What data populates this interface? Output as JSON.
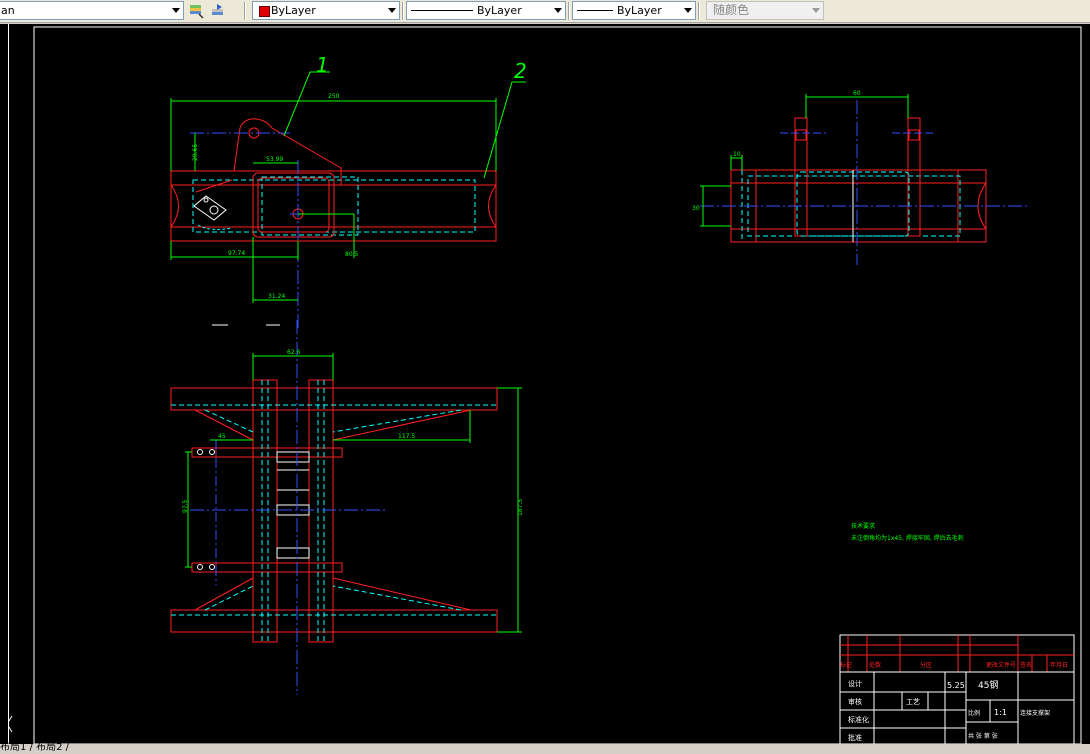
{
  "toolbar": {
    "layer_tail": "an",
    "color_label": "ByLayer",
    "linetype_label": "ByLayer",
    "lineweight_label": "ByLayer",
    "plotstyle_label": "随颜色",
    "color_swatch": "#e00000"
  },
  "drawing": {
    "callouts": [
      "1",
      "2"
    ],
    "top_view_dims": [
      "250",
      "29.65",
      "53.99",
      "97.74",
      "31.24",
      "80.5"
    ],
    "side_view_dims": [
      "60",
      "10",
      "30"
    ],
    "plan_view_dims": [
      "62.6",
      "45",
      "117.5",
      "97.5",
      "187.5"
    ],
    "notes": [
      "技术要求",
      "未注倒角均为1x45, 焊接牢固, 焊后去毛刺"
    ]
  },
  "title_block": {
    "rows_top": [
      "",
      ""
    ],
    "header": [
      "标记",
      "处数",
      "分区",
      "更改文件号",
      "签名",
      "年月日"
    ],
    "design": "设计",
    "review": "审核",
    "standard": "标准化",
    "process": "工艺",
    "approve": "批准",
    "weight": "5.25",
    "material": "45钢",
    "scale_label": "比例",
    "scale": "1:1",
    "part_name": "连接支撑架",
    "sheet": "共 张 第 张"
  },
  "tabs": {
    "layout_tabs": "布局1 / 布局2 /"
  },
  "colors": {
    "red": "#ff2020",
    "cyan": "#00ffff",
    "green": "#00ff00",
    "blue": "#3050ff",
    "white": "#ffffff",
    "canvas": "#000000"
  }
}
